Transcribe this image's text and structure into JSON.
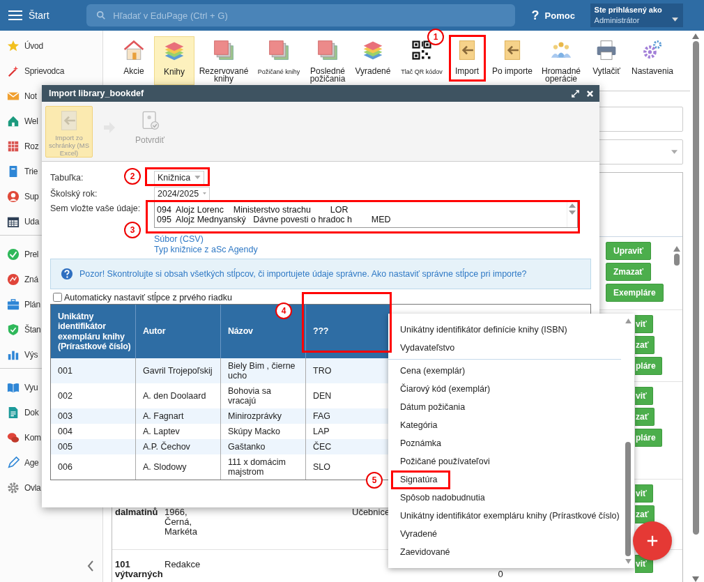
{
  "header": {
    "menu_label": "Štart",
    "search": {
      "placeholder": "Hľadať v EduPage (Ctrl + G)"
    },
    "help": {
      "icon": "?",
      "label": "Pomoc"
    },
    "user": {
      "caption": "Ste prihlásený ako",
      "name": "Administrátor"
    }
  },
  "sidebar": {
    "groups": [
      {
        "items": [
          {
            "label": "Úvod",
            "kind": "star"
          },
          {
            "label": "Sprievodca",
            "kind": "wand"
          },
          {
            "label": "Not",
            "kind": "mail"
          },
          {
            "label": "Wel",
            "kind": "house"
          },
          {
            "label": "Roz",
            "kind": "grid"
          },
          {
            "label": "Trie",
            "kind": "notebook"
          },
          {
            "label": "Sup",
            "kind": "person"
          },
          {
            "label": "Uda",
            "kind": "calendar"
          }
        ]
      },
      {
        "items": [
          {
            "label": "Prel",
            "kind": "check"
          },
          {
            "label": "Zná",
            "kind": "chart"
          },
          {
            "label": "Plán",
            "kind": "briefcase"
          },
          {
            "label": "Štan",
            "kind": "shield"
          },
          {
            "label": "Výs",
            "kind": "bars"
          }
        ]
      },
      {
        "items": [
          {
            "label": "Vyu",
            "kind": "book"
          },
          {
            "label": "Dok",
            "kind": "document"
          },
          {
            "label": "Kom",
            "kind": "chat"
          },
          {
            "label": "Age",
            "kind": "pen"
          },
          {
            "label": "Ovla",
            "kind": "gear"
          }
        ]
      }
    ]
  },
  "toolbar": {
    "items": [
      {
        "label": "Akcie",
        "kind": "house",
        "selected": false,
        "small": false
      },
      {
        "label": "Knihy",
        "kind": "stack",
        "selected": true,
        "small": false
      },
      {
        "label": "Rezervované knihy",
        "kind": "pages",
        "selected": false,
        "small": false
      },
      {
        "label": "Požičané knihy",
        "kind": "pages",
        "selected": false,
        "small": true
      },
      {
        "label": "Posledné požičania",
        "kind": "pages",
        "selected": false,
        "small": false
      },
      {
        "label": "Vyradené",
        "kind": "stack",
        "selected": false,
        "small": false
      },
      {
        "label": "Tlač QR kódov",
        "kind": "qr",
        "selected": false,
        "small": true
      },
      {
        "label": "Import",
        "kind": "import",
        "selected": false,
        "small": false
      },
      {
        "label": "Po importe",
        "kind": "import",
        "selected": false,
        "small": false
      },
      {
        "label": "Hromadné operácie",
        "kind": "people",
        "selected": false,
        "small": false
      },
      {
        "label": "Vytlačiť",
        "kind": "printer",
        "selected": false,
        "small": false
      },
      {
        "label": "Nastavenia",
        "kind": "gears",
        "selected": false,
        "small": false
      }
    ]
  },
  "background": {
    "rows": [
      {
        "title": "",
        "author": "",
        "type": "",
        "count": "",
        "partly_covered": false,
        "buttons": [
          "Upraviť",
          "Zmazať",
          "Exempláre"
        ]
      },
      {
        "title": "",
        "author": "",
        "type": "",
        "count": "",
        "partly_covered": true,
        "buttons": [
          "viť",
          "zať",
          "pláre"
        ]
      },
      {
        "title": "",
        "author": "",
        "type": "",
        "count": "",
        "partly_covered": true,
        "buttons": [
          "viť",
          "zať",
          "pláre"
        ]
      },
      {
        "title": "dalmatinů",
        "author": "1966,\nČerná,\nMarkéta",
        "type": "Učebnice",
        "count": "",
        "partly_covered": true,
        "buttons": [
          "viť",
          "zať"
        ]
      },
      {
        "title": "101\nvýtvarných",
        "author": "Redakce",
        "type": "",
        "count": "0",
        "partly_covered": true,
        "buttons": [
          "viť"
        ]
      }
    ]
  },
  "dialog": {
    "title": "Import library_bookdef",
    "actions": [
      {
        "label": "Import zo schránky (MS Excel)",
        "kind": "import",
        "selected": true
      },
      {
        "label": "Potvrdiť",
        "kind": "confirm",
        "selected": false
      }
    ],
    "table_field": {
      "label": "Tabuľka:",
      "value": "Knižnica"
    },
    "year_field": {
      "label": "Školský rok:",
      "value": "2024/2025"
    },
    "data_field": {
      "label": "Sem vložte vaše údaje:",
      "value": "094  Alojz Lorenc    Ministerstvo strachu        LOR\n095  Alojz Mednyanský   Dávne povesti o hradoc h        MED"
    },
    "links": [
      "Súbor (CSV)",
      "Typ knižnice z aSc Agendy"
    ],
    "notice": "Pozor! Skontrolujte si obsah všetkých stĺpcov, či importujete údaje správne. Ako nastaviť správne stĺpce pri importe?",
    "auto_columns": {
      "label": "Automaticky nastaviť stĺpce z prvého riadku",
      "checked": false
    },
    "table": {
      "columns": [
        "Unikátny identifikátor exempláru knihy (Prírastkové číslo)",
        "Autor",
        "Názov",
        "???"
      ],
      "rows": [
        [
          "001",
          "Gavril Trojepoľskij",
          "Biely Bim , čierne ucho",
          "TRO"
        ],
        [
          "002",
          "A. den Doolaard",
          "Bohovia sa vracajú",
          "DEN"
        ],
        [
          "003",
          "A. Fagnart",
          "Minirozprávky",
          "FAG"
        ],
        [
          "004",
          "A. Laptev",
          "Skúpy Macko",
          "LAP"
        ],
        [
          "005",
          "A.P. Čechov",
          "Gaštanko",
          "ČEC"
        ],
        [
          "006",
          "A. Slodowy",
          "111 x domácim majstrom",
          "SLO"
        ]
      ]
    }
  },
  "dropdown": {
    "groups": [
      {
        "options": [
          "Unikátny identifikátor definície knihy (ISBN)",
          "Vydavateľstvo"
        ]
      },
      {
        "options": [
          "Cena (exemplár)",
          "Čiarový kód (exemplár)",
          "Dátum požičania",
          "Kategória",
          "Poznámka",
          "Požičané používateľovi",
          "Signatúra",
          "Spôsob nadobudnutia",
          "Unikátny identifikátor exempláru knihy (Prírastkové číslo)",
          "Vyradené",
          "Zaevidované"
        ]
      }
    ]
  },
  "annotations": [
    {
      "number": "1"
    },
    {
      "number": "2"
    },
    {
      "number": "3"
    },
    {
      "number": "4"
    },
    {
      "number": "5"
    }
  ]
}
